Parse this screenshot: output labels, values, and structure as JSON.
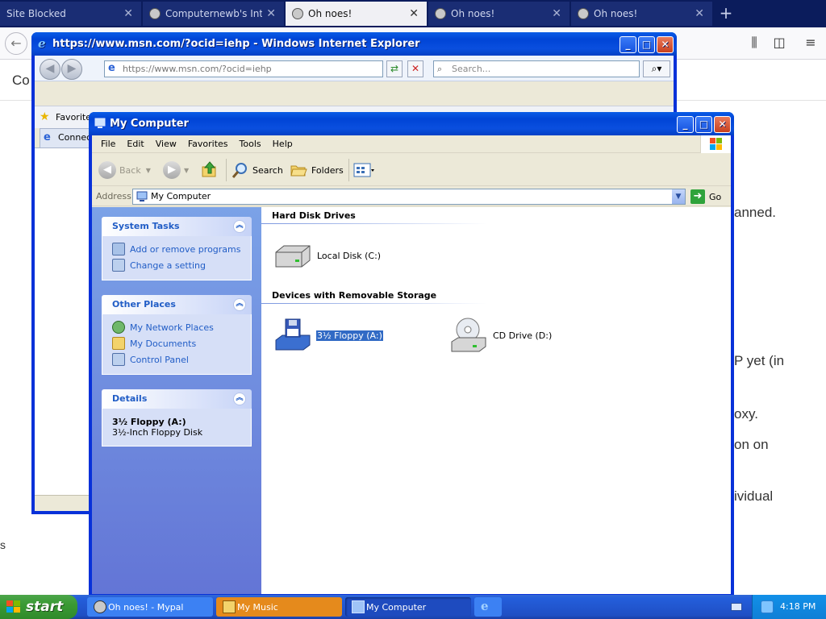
{
  "browser": {
    "tabs": [
      {
        "label": "Site Blocked",
        "active": false
      },
      {
        "label": "Computernewb's Intern",
        "active": false
      },
      {
        "label": "Oh noes!",
        "active": true
      },
      {
        "label": "Oh noes!",
        "active": false
      },
      {
        "label": "Oh noes!",
        "active": false
      }
    ],
    "new_tab": "+",
    "close_glyph": "✕",
    "back_glyph": "←",
    "page_fragments": {
      "co": "Co",
      "anned": "anned.",
      "p_yet": "P yet (in",
      "oxy": "oxy.",
      "on_on": "on on",
      "ividual": "ividual",
      "s": "s"
    }
  },
  "ie_window": {
    "title": "https://www.msn.com/?ocid=iehp - Windows Internet Explorer",
    "address": "https://www.msn.com/?ocid=iehp",
    "search_placeholder": "Search...",
    "favorites": "Favorites",
    "tab_label": "Connecti"
  },
  "mycomputer": {
    "title": "My Computer",
    "menu": [
      "File",
      "Edit",
      "View",
      "Favorites",
      "Tools",
      "Help"
    ],
    "toolbar": {
      "back": "Back",
      "search": "Search",
      "folders": "Folders"
    },
    "address_label": "Address",
    "address_value": "My Computer",
    "go": "Go",
    "system_tasks": {
      "title": "System Tasks",
      "items": [
        "Add or remove programs",
        "Change a setting"
      ]
    },
    "other_places": {
      "title": "Other Places",
      "items": [
        "My Network Places",
        "My Documents",
        "Control Panel"
      ]
    },
    "details": {
      "title": "Details",
      "name": "3½ Floppy (A:)",
      "type": "3½-Inch Floppy Disk"
    },
    "groups": {
      "hdd": "Hard Disk Drives",
      "removable": "Devices with Removable Storage"
    },
    "items": {
      "local_disk": "Local Disk (C:)",
      "floppy": "3½ Floppy (A:)",
      "cd": "CD Drive (D:)"
    }
  },
  "taskbar": {
    "start": "start",
    "buttons": [
      "Oh noes! - Mypal",
      "My Music",
      "My Computer"
    ],
    "clock": "4:18 PM"
  },
  "colors": {
    "xp_blue": "#0831d9",
    "selection": "#316ac5",
    "taskpane_link": "#215dc6"
  }
}
